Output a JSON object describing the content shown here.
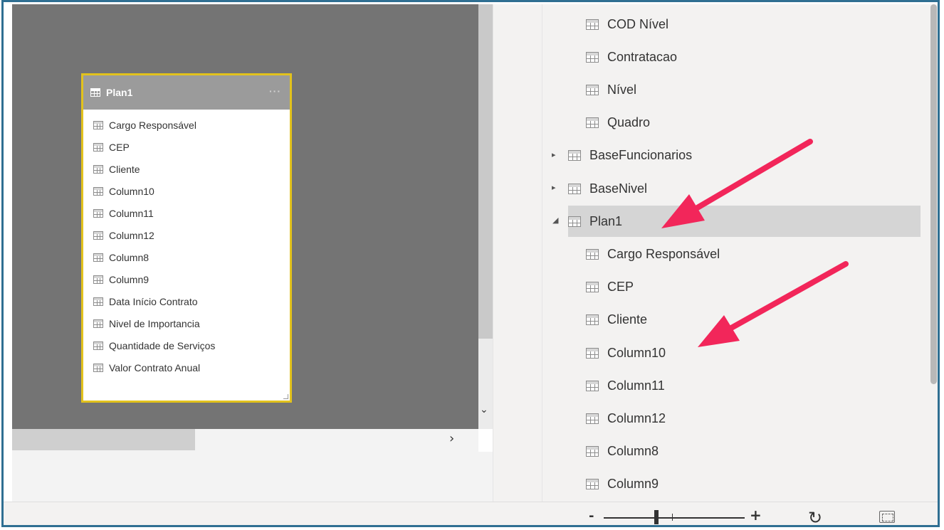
{
  "card": {
    "title": "Plan1",
    "menu": "···",
    "fields": [
      "Cargo Responsável",
      "CEP",
      "Cliente",
      "Column10",
      "Column11",
      "Column12",
      "Column8",
      "Column9",
      "Data Início Contrato",
      "Nivel de Importancia",
      "Quantidade de Serviços",
      "Valor Contrato Anual"
    ]
  },
  "left_scroll": {
    "down_arrow": "⌄",
    "right_arrow": "›"
  },
  "fields_pane": {
    "top_fields": [
      "COD Nível",
      "Contratacao",
      "Nível",
      "Quadro"
    ],
    "tables": [
      {
        "name": "BaseFuncionarios",
        "expanded": false
      },
      {
        "name": "BaseNivel",
        "expanded": false
      },
      {
        "name": "Plan1",
        "expanded": true,
        "selected": true
      }
    ],
    "plan1_fields": [
      "Cargo Responsável",
      "CEP",
      "Cliente",
      "Column10",
      "Column11",
      "Column12",
      "Column8",
      "Column9"
    ],
    "collapsed_caret": "▸",
    "expanded_caret": "◢"
  },
  "bottom_bar": {
    "zoom_minus": "-",
    "zoom_plus": "+",
    "refresh_icon": "refresh-icon",
    "fit_icon": "fit-to-page-icon"
  },
  "colors": {
    "card_border": "#e2c21d",
    "arrow": "#f2265a",
    "canvas": "#747474",
    "selected_row": "#d5d5d5"
  }
}
